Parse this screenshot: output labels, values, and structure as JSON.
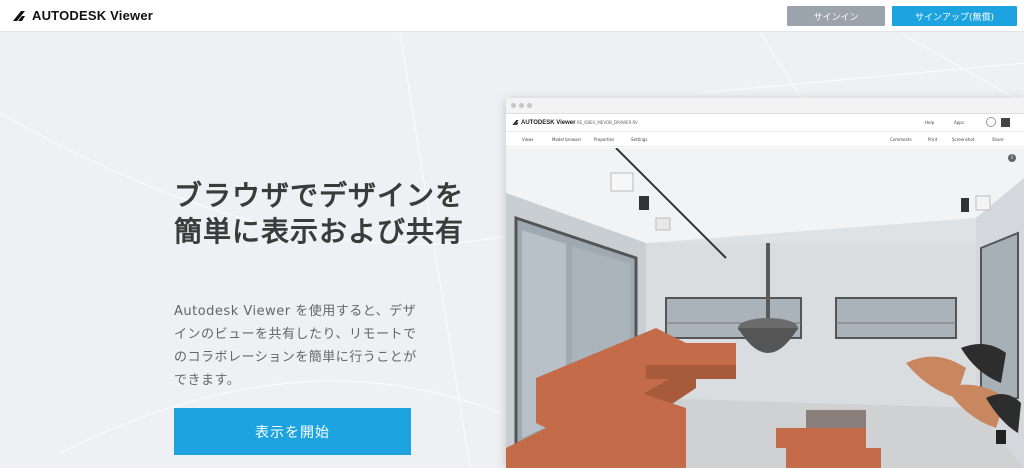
{
  "header": {
    "logo_text": "AUTODESK Viewer",
    "signin_label": "サインイン",
    "signup_label": "サインアップ(無償)"
  },
  "hero": {
    "title": "ブラウザでデザインを簡単に表示および共有",
    "description": "Autodesk Viewer を使用すると、デザインのビューを共有したり、リモートでのコラボレーションを簡単に行うことができます。",
    "cta_label": "表示を開始"
  },
  "preview": {
    "logo_text": "AUTODESK Viewer",
    "path_text": "› RE_OBEV_MEVOB_DRAWER.RV",
    "help_label": "Help",
    "apps_label": "Apps",
    "toolbar_left": [
      "Views",
      "Model browser",
      "Properties",
      "Settings"
    ],
    "toolbar_right": [
      "Comments",
      "Print",
      "Screenshot",
      "Share"
    ],
    "info_glyph": "i"
  },
  "colors": {
    "accent": "#1ca3e0",
    "signin_bg": "#9ba3ad",
    "page_bg": "#eef0f3",
    "sofa": "#c46b4a"
  }
}
